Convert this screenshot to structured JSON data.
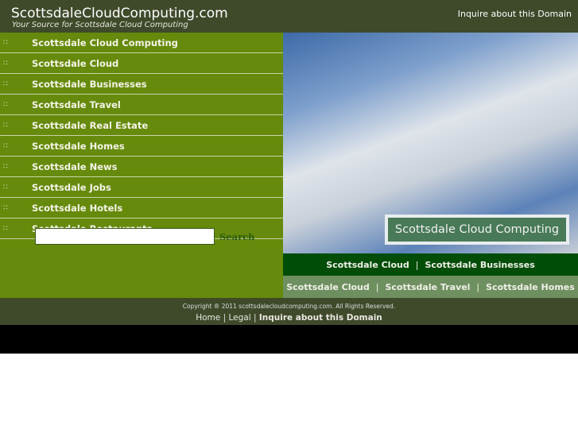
{
  "header": {
    "site_title": "ScottsdaleCloudComputing.com",
    "tagline": "Your Source for Scottsdale Cloud Computing",
    "inquire": "Inquire about this Domain"
  },
  "nav": {
    "icon": "link-bullet-icon",
    "items": [
      "Scottsdale Cloud Computing",
      "Scottsdale Cloud",
      "Scottsdale Businesses",
      "Scottsdale Travel",
      "Scottsdale Real Estate",
      "Scottsdale Homes",
      "Scottsdale News",
      "Scottsdale Jobs",
      "Scottsdale Hotels",
      "Scottsdale Restaurants"
    ]
  },
  "search": {
    "value": "",
    "button": "Search"
  },
  "hero": {
    "caption": "Scottsdale Cloud Computing"
  },
  "bar1": [
    "Scottsdale Cloud",
    "Scottsdale Businesses"
  ],
  "bar2": [
    "Scottsdale Cloud",
    "Scottsdale Travel",
    "Scottsdale Homes"
  ],
  "separator": "|",
  "footer": {
    "copyright": "Copyright ® 2011 scottsdalecloudcomputing.com. All Rights Reserved.",
    "links": [
      "Home",
      "Legal",
      "Inquire about this Domain"
    ]
  },
  "colors": {
    "header": "#3f4a2b",
    "nav": "#668a0b",
    "bar1": "#004d07",
    "bar2": "#6e9060"
  }
}
